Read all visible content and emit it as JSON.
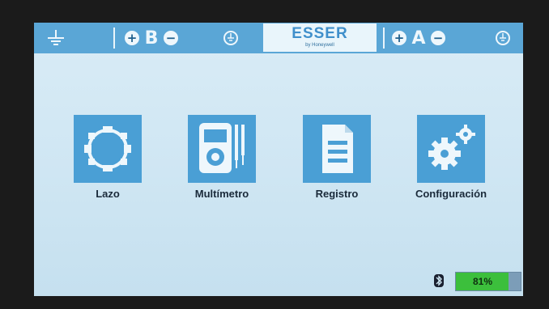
{
  "header": {
    "bus_b_letter": "B",
    "bus_a_letter": "A",
    "plus_symbol": "+",
    "minus_symbol": "−",
    "logo": {
      "name": "ESSER",
      "tagline": "by Honeywell"
    },
    "icons": [
      "ground-icon",
      "shield-ground-icon"
    ]
  },
  "menu": {
    "items": [
      {
        "label": "Lazo",
        "icon": "loop-icon"
      },
      {
        "label": "Multímetro",
        "icon": "multimeter-icon"
      },
      {
        "label": "Registro",
        "icon": "log-document-icon"
      },
      {
        "label": "Configuración",
        "icon": "gears-icon"
      }
    ]
  },
  "status": {
    "connection_icon": "bluetooth-icon",
    "battery_percent": 81,
    "battery_label": "81%"
  },
  "colors": {
    "header": "#5aa6d6",
    "tile": "#4a9fd5",
    "screen": "#d4e9f5",
    "battery_fill": "#3cbf3c"
  }
}
